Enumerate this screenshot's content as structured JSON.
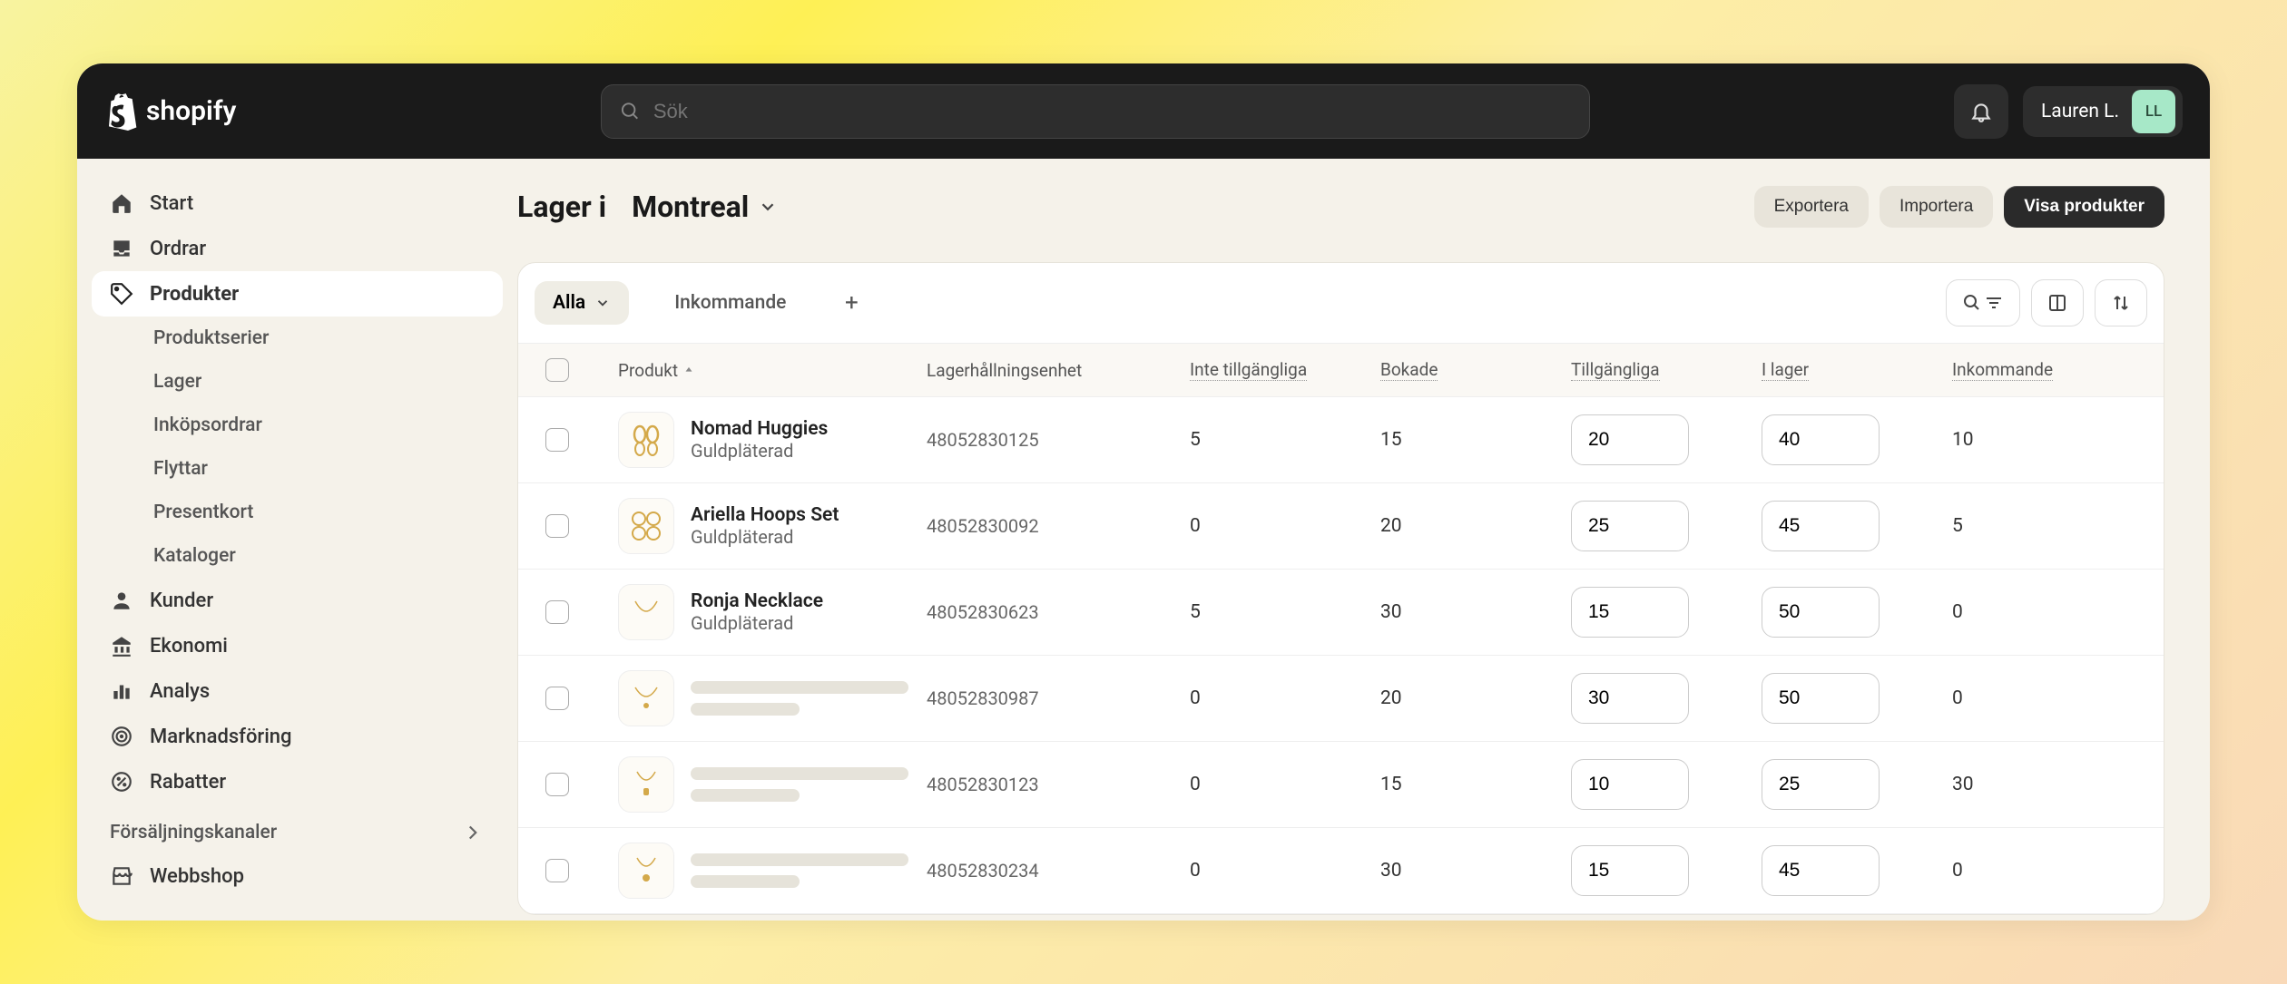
{
  "brand": "shopify",
  "search": {
    "placeholder": "Sök"
  },
  "user": {
    "name": "Lauren L.",
    "initials": "LL"
  },
  "sidebar": {
    "items": [
      {
        "label": "Start",
        "icon": "home"
      },
      {
        "label": "Ordrar",
        "icon": "inbox"
      },
      {
        "label": "Produkter",
        "icon": "tag",
        "active": true
      },
      {
        "label": "Kunder",
        "icon": "user"
      },
      {
        "label": "Ekonomi",
        "icon": "bank"
      },
      {
        "label": "Analys",
        "icon": "chart"
      },
      {
        "label": "Marknadsföring",
        "icon": "target"
      },
      {
        "label": "Rabatter",
        "icon": "discount"
      }
    ],
    "subItems": [
      {
        "label": "Produktserier"
      },
      {
        "label": "Lager"
      },
      {
        "label": "Inköpsordrar"
      },
      {
        "label": "Flyttar"
      },
      {
        "label": "Presentkort"
      },
      {
        "label": "Kataloger"
      }
    ],
    "channelsHeading": "Försäljningskanaler",
    "channels": [
      {
        "label": "Webbshop",
        "icon": "shop"
      }
    ]
  },
  "page": {
    "title_prefix": "Lager i",
    "location": "Montreal"
  },
  "actions": {
    "export": "Exportera",
    "import": "Importera",
    "viewProducts": "Visa produkter"
  },
  "tabs": {
    "all": "Alla",
    "incoming": "Inkommande"
  },
  "columns": {
    "product": "Produkt",
    "sku": "Lagerhållningsenhet",
    "unavailable": "Inte tillgängliga",
    "booked": "Bokade",
    "available": "Tillgängliga",
    "inStock": "I lager",
    "incoming": "Inkommande"
  },
  "rows": [
    {
      "name": "Nomad Huggies",
      "variant": "Guldpläterad",
      "sku": "48052830125",
      "unavailable": "5",
      "booked": "15",
      "available": "20",
      "stock": "40",
      "incoming": "10",
      "img": "huggies"
    },
    {
      "name": "Ariella Hoops Set",
      "variant": "Guldpläterad",
      "sku": "48052830092",
      "unavailable": "0",
      "booked": "20",
      "available": "25",
      "stock": "45",
      "incoming": "5",
      "img": "hoops"
    },
    {
      "name": "Ronja Necklace",
      "variant": "Guldpläterad",
      "sku": "48052830623",
      "unavailable": "5",
      "booked": "30",
      "available": "15",
      "stock": "50",
      "incoming": "0",
      "img": "necklace"
    },
    {
      "skeleton": true,
      "sku": "48052830987",
      "unavailable": "0",
      "booked": "20",
      "available": "30",
      "stock": "50",
      "incoming": "0",
      "img": "necklace2"
    },
    {
      "skeleton": true,
      "sku": "48052830123",
      "unavailable": "0",
      "booked": "15",
      "available": "10",
      "stock": "25",
      "incoming": "30",
      "img": "pendant"
    },
    {
      "skeleton": true,
      "sku": "48052830234",
      "unavailable": "0",
      "booked": "30",
      "available": "15",
      "stock": "45",
      "incoming": "0",
      "img": "pendant2"
    }
  ]
}
